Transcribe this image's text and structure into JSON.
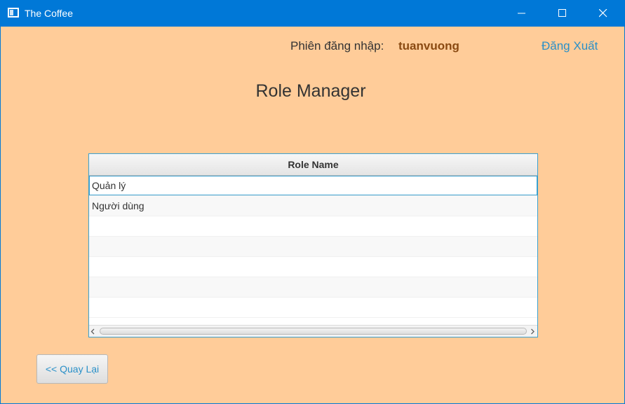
{
  "window": {
    "title": "The Coffee",
    "controls": [
      "minimize-icon",
      "maximize-icon",
      "close-icon"
    ]
  },
  "header": {
    "session_label": "Phiên đăng nhập:",
    "username": "tuanvuong",
    "logout_label": "Đăng Xuất"
  },
  "page": {
    "title": "Role Manager"
  },
  "table": {
    "column_header": "Role Name",
    "rows": [
      "Quản lý",
      "Người dùng",
      "",
      "",
      "",
      "",
      ""
    ],
    "selected_row": 0
  },
  "footer": {
    "back_label": "<< Quay Lại"
  },
  "colors": {
    "background": "#ffcc99",
    "titlebar": "#0078d7",
    "accent_link": "#2a90c8",
    "username": "#8a4a12",
    "table_border": "#3aa0cf"
  }
}
